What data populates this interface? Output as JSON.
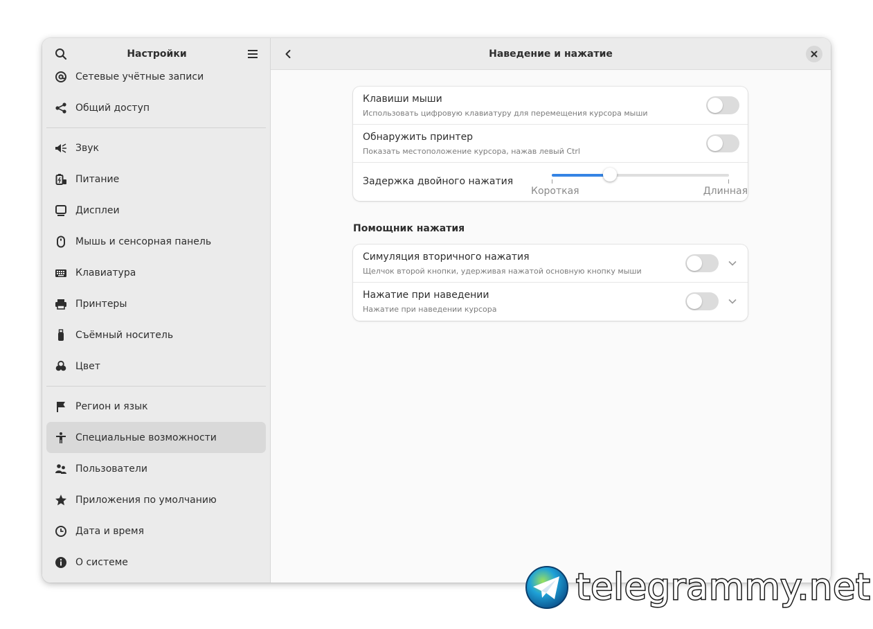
{
  "sidebar": {
    "title": "Настройки",
    "items": [
      {
        "label": "Сетевые учётные записи",
        "icon": "at-icon"
      },
      {
        "label": "Общий доступ",
        "icon": "share-icon"
      },
      {
        "label": "Звук",
        "icon": "speaker-icon"
      },
      {
        "label": "Питание",
        "icon": "battery-icon"
      },
      {
        "label": "Дисплеи",
        "icon": "display-icon"
      },
      {
        "label": "Мышь и сенсорная панель",
        "icon": "mouse-icon"
      },
      {
        "label": "Клавиатура",
        "icon": "keyboard-icon"
      },
      {
        "label": "Принтеры",
        "icon": "printer-icon"
      },
      {
        "label": "Съёмный носитель",
        "icon": "usb-icon"
      },
      {
        "label": "Цвет",
        "icon": "color-icon"
      },
      {
        "label": "Регион и язык",
        "icon": "flag-icon"
      },
      {
        "label": "Специальные возможности",
        "icon": "accessibility-icon",
        "active": true
      },
      {
        "label": "Пользователи",
        "icon": "users-icon"
      },
      {
        "label": "Приложения по умолчанию",
        "icon": "star-icon"
      },
      {
        "label": "Дата и время",
        "icon": "clock-icon"
      },
      {
        "label": "О системе",
        "icon": "info-icon"
      }
    ]
  },
  "main": {
    "title": "Наведение и нажатие",
    "group1": {
      "rows": [
        {
          "title": "Клавиши мыши",
          "subtitle": "Использовать цифровую клавиатуру для перемещения курсора мыши",
          "enabled": false
        },
        {
          "title": "Обнаружить принтер",
          "subtitle": "Показать местоположение курсора, нажав левый Ctrl",
          "enabled": false
        }
      ],
      "slider": {
        "title": "Задержка двойного нажатия",
        "min_label": "Короткая",
        "max_label": "Длинная",
        "value_fraction": 0.33
      }
    },
    "group2": {
      "title": "Помощник нажатия",
      "rows": [
        {
          "title": "Симуляция вторичного нажатия",
          "subtitle": "Щелчок второй кнопки, удерживая нажатой основную кнопку мыши",
          "enabled": false
        },
        {
          "title": "Нажатие при наведении",
          "subtitle": "Нажатие при наведении курсора",
          "enabled": false
        }
      ]
    }
  },
  "watermark": {
    "text": "telegrammy.net"
  },
  "colors": {
    "accent": "#3584e4",
    "sidebar_bg": "#ebebeb",
    "active_item": "#d9d9d9"
  }
}
